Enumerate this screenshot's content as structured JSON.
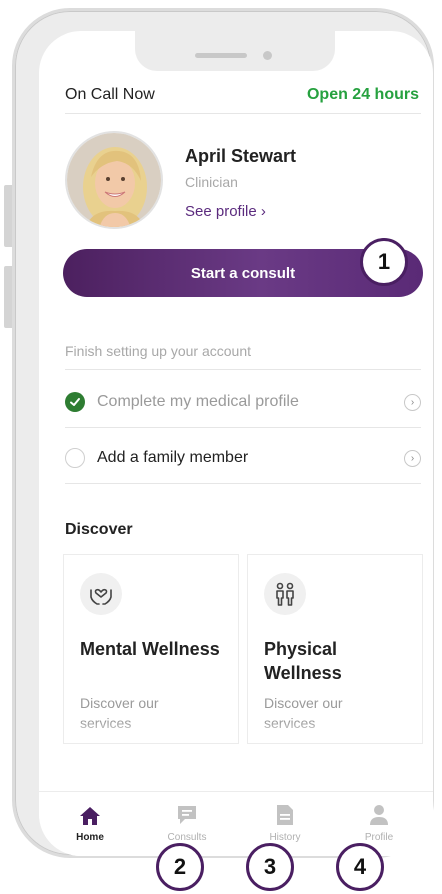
{
  "header": {
    "on_call": "On Call Now",
    "hours": "Open 24 hours"
  },
  "clinician": {
    "name": "April Stewart",
    "role": "Clinician",
    "see_profile": "See profile ›"
  },
  "consult_button": "Start a consult",
  "setup": {
    "title": "Finish setting up your account",
    "items": [
      {
        "label": "Complete my medical profile",
        "done": true
      },
      {
        "label": "Add a family member",
        "done": false
      }
    ]
  },
  "discover": {
    "title": "Discover",
    "cards": [
      {
        "title": "Mental Wellness",
        "desc": "Discover our services",
        "icon": "heart-hands-icon"
      },
      {
        "title": "Physical Wellness",
        "desc": "Discover our services",
        "icon": "people-icon"
      }
    ]
  },
  "tabs": [
    {
      "label": "Home",
      "icon": "home-icon",
      "active": true
    },
    {
      "label": "Consults",
      "icon": "chat-icon",
      "active": false
    },
    {
      "label": "History",
      "icon": "document-icon",
      "active": false
    },
    {
      "label": "Profile",
      "icon": "person-icon",
      "active": false
    }
  ],
  "callouts": [
    "1",
    "2",
    "3",
    "4"
  ],
  "colors": {
    "accent": "#4a1f62",
    "open_green": "#26a13f",
    "check_green": "#2e7d32"
  }
}
